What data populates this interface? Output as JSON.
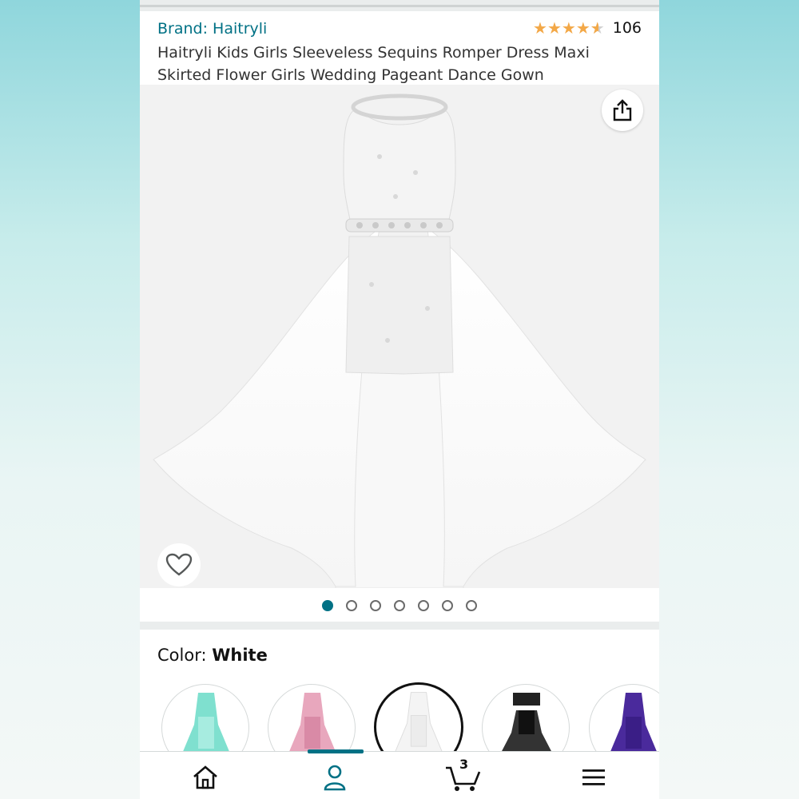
{
  "header": {
    "brand_text": "Brand: Haitryli",
    "rating_value": 4.5,
    "rating_count": "106",
    "title": "Haitryli Kids Girls Sleeveless Sequins Romper Dress Maxi Skirted Flower Girls Wedding Pageant Dance Gown"
  },
  "gallery": {
    "share_icon": "share-icon",
    "heart_icon": "heart-icon",
    "dot_count": 7,
    "active_dot_index": 0
  },
  "color_selector": {
    "label": "Color: ",
    "value": "White",
    "swatches": [
      {
        "name": "Mint",
        "color": "#7fe0cf"
      },
      {
        "name": "Pink",
        "color": "#e8a7bd"
      },
      {
        "name": "White",
        "color": "#f4f4f4",
        "selected": true
      },
      {
        "name": "Black",
        "color": "#222222"
      },
      {
        "name": "Purple",
        "color": "#4a2a9c"
      }
    ]
  },
  "bottom_nav": {
    "items": [
      {
        "icon": "home-icon"
      },
      {
        "icon": "user-icon",
        "active": true
      },
      {
        "icon": "cart-icon",
        "badge": "3"
      },
      {
        "icon": "menu-icon"
      }
    ]
  },
  "colors": {
    "link": "#007185",
    "star": "#f3a847",
    "text": "#333333"
  }
}
